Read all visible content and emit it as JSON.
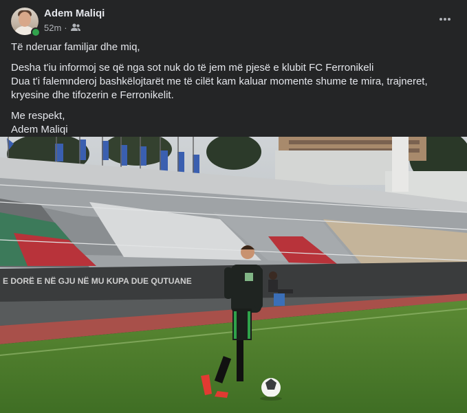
{
  "post": {
    "author": "Adem Maliqi",
    "timestamp": "52m",
    "separator": "·",
    "audience_icon": "friends-icon",
    "more_icon": "more-horizontal-icon",
    "text": {
      "greeting": "Të nderuar familjar dhe miq,",
      "line1": "Desha t'iu informoj se që nga sot nuk do të jem më pjesë e klubit FC Ferronikeli",
      "line2": "Dua t'i falemnderoj bashkëlojtarët me të cilët kam kaluar momente shume te mira, trajneret, kryesine dhe tifozerin e Ferronikelit.",
      "signoff": "Me respekt,",
      "signature": "Adem Maliqi"
    },
    "photo": {
      "banner_text": "E DORË E NË GJU NË MU KUPA DUE QUTUANE"
    }
  },
  "colors": {
    "background": "#242526",
    "primary_text": "#e4e6eb",
    "secondary_text": "#b0b3b8",
    "online": "#31a24c"
  }
}
